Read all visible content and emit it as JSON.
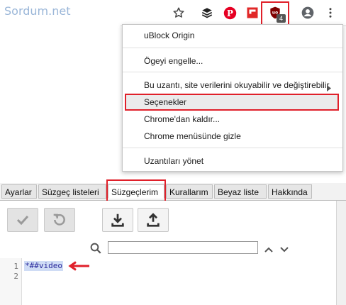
{
  "watermark": "Sordum.net",
  "toolbar": {
    "icons": [
      "star-icon",
      "layers-extension-icon",
      "pinterest-icon",
      "flipboard-icon",
      "ublock-origin-icon",
      "account-icon",
      "more-vert-icon"
    ],
    "ublock_badge": "4",
    "colors": {
      "highlight": "#e0202a",
      "ublock": "#800000",
      "pinterest": "#e60023",
      "flipboard": "#e12828"
    }
  },
  "context_menu": {
    "items": [
      "uBlock Origin",
      "Ögeyi engelle...",
      "Bu uzantı, site verilerini okuyabilir ve değiştirebilir",
      "Seçenekler",
      "Chrome'dan kaldır...",
      "Chrome menüsünde gizle",
      "Uzantıları yönet"
    ]
  },
  "tabs": [
    "Ayarlar",
    "Süzgeç listeleri",
    "Süzgeçlerim",
    "Kurallarım",
    "Beyaz liste",
    "Hakkında"
  ],
  "active_tab": "Süzgeçlerim",
  "editor": {
    "line_numbers": [
      "1",
      "2"
    ],
    "lines": [
      "*##video",
      ""
    ]
  }
}
